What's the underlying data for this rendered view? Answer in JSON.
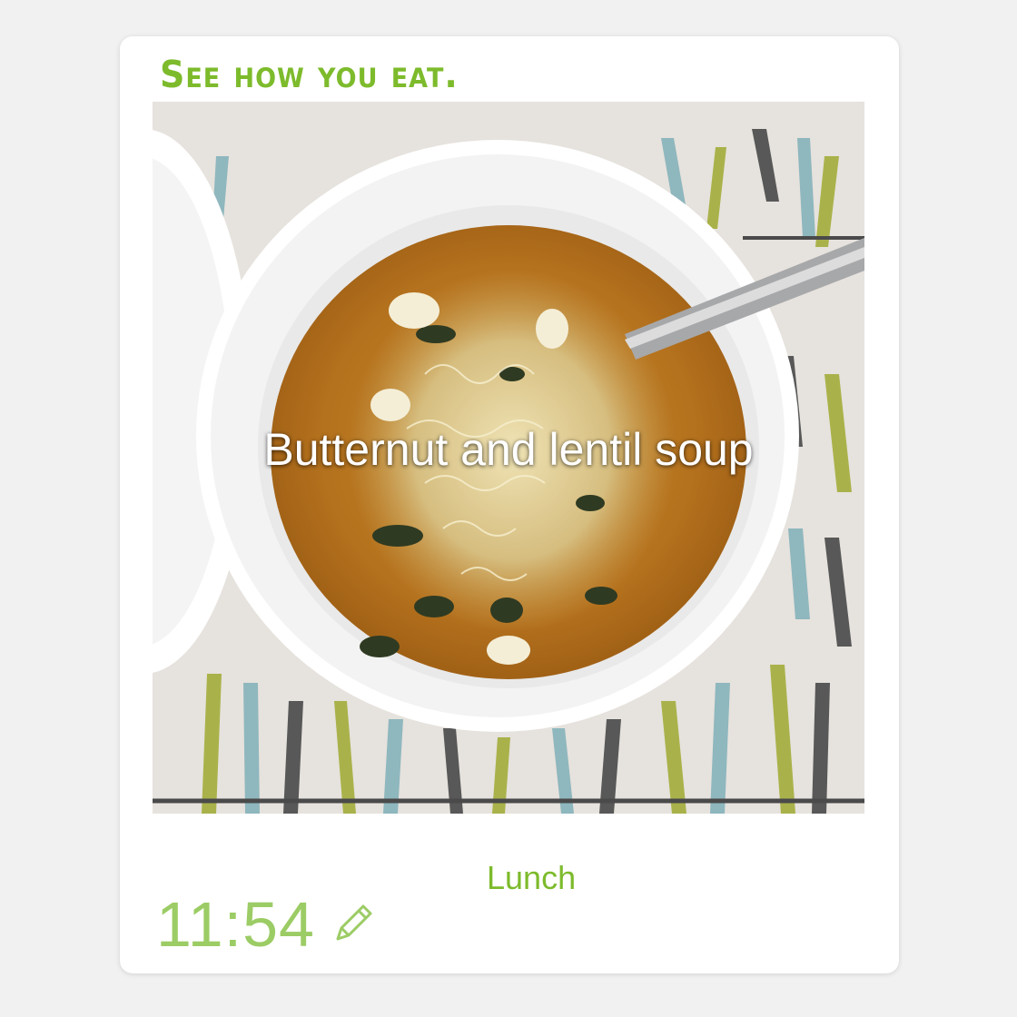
{
  "brand": {
    "tagline": "See how you eat."
  },
  "entry": {
    "caption": "Butternut and lentil soup",
    "meal": "Lunch",
    "time": "11:54",
    "edit_icon": "pencil-icon"
  },
  "colors": {
    "accent": "#7dbb2c",
    "time": "#9ccc65"
  }
}
